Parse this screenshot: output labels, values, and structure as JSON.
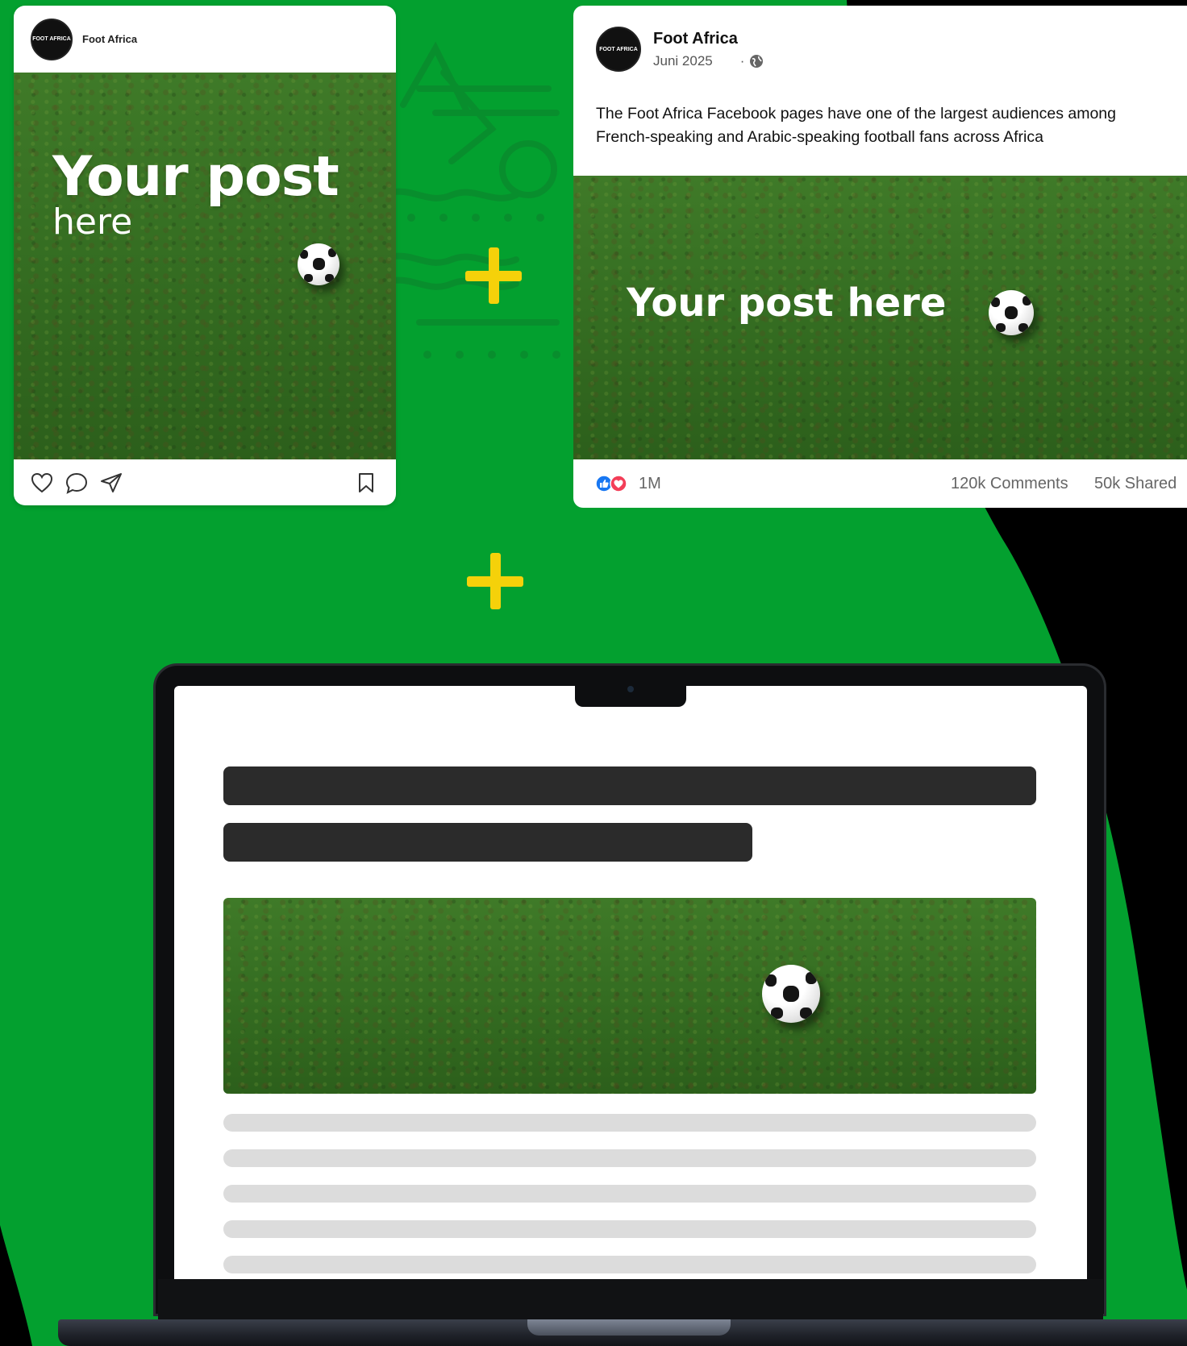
{
  "colors": {
    "brand_green": "#03a02f",
    "accent_yellow": "#f5d10a",
    "black": "#000000"
  },
  "instagram": {
    "account_name": "Foot Africa",
    "logo_text": "FOOT AFRICA",
    "post_title": "Your post",
    "post_subtitle": "here",
    "icons": [
      "heart-icon",
      "comment-icon",
      "share-icon",
      "bookmark-icon"
    ]
  },
  "facebook": {
    "page_name": "Foot Africa",
    "logo_text": "FOOT AFRICA",
    "date": "Juni 2025",
    "privacy_icon": "globe-icon",
    "text": "The Foot Africa Facebook pages have one of the largest audiences among French-speaking and Arabic-speaking football fans across Africa",
    "post_title": "Your post here",
    "reactions": {
      "icons": [
        "like-icon",
        "love-icon"
      ],
      "count": "1M"
    },
    "comments": "120k Comments",
    "shares": "50k Shared"
  },
  "plus_icons": [
    "plus-icon",
    "plus-icon"
  ],
  "laptop": {
    "title_bars": 2,
    "text_lines": 5
  }
}
